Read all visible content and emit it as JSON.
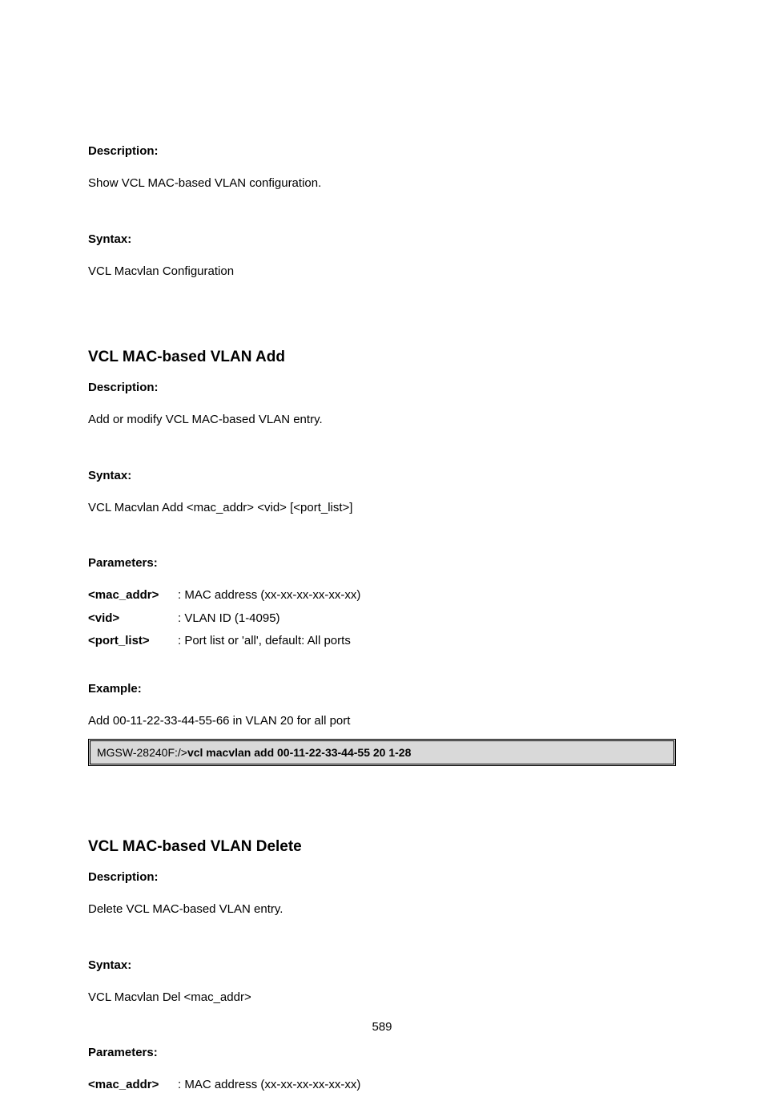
{
  "sec1": {
    "desc_heading": "Description:",
    "desc_text": "Show VCL MAC-based VLAN configuration.",
    "syntax_heading": "Syntax:",
    "syntax_text": "VCL Macvlan Configuration"
  },
  "sec2": {
    "title": "VCL MAC-based VLAN Add",
    "desc_heading": "Description:",
    "desc_text": "Add or modify VCL MAC-based VLAN entry.",
    "syntax_heading": "Syntax:",
    "syntax_text": "VCL Macvlan Add <mac_addr> <vid> [<port_list>]",
    "params_heading": "Parameters:",
    "params": [
      {
        "label": "<mac_addr>",
        "desc": ": MAC address (xx-xx-xx-xx-xx-xx)"
      },
      {
        "label": "<vid>",
        "desc": ": VLAN ID (1-4095)"
      },
      {
        "label": "<port_list>",
        "desc": ": Port list or 'all', default: All ports"
      }
    ],
    "example_heading": "Example:",
    "example_text": "Add 00-11-22-33-44-55-66 in VLAN 20 for all port",
    "example_box_prefix": "MGSW-28240F:/>",
    "example_box_cmd": "vcl macvlan add 00-11-22-33-44-55 20 1-28"
  },
  "sec3": {
    "title": "VCL MAC-based VLAN Delete",
    "desc_heading": "Description:",
    "desc_text": "Delete VCL MAC-based VLAN entry.",
    "syntax_heading": "Syntax:",
    "syntax_text": "VCL Macvlan Del <mac_addr>",
    "params_heading": "Parameters:",
    "params": [
      {
        "label": "<mac_addr>",
        "desc": ": MAC address (xx-xx-xx-xx-xx-xx)"
      }
    ]
  },
  "page_number": "589"
}
